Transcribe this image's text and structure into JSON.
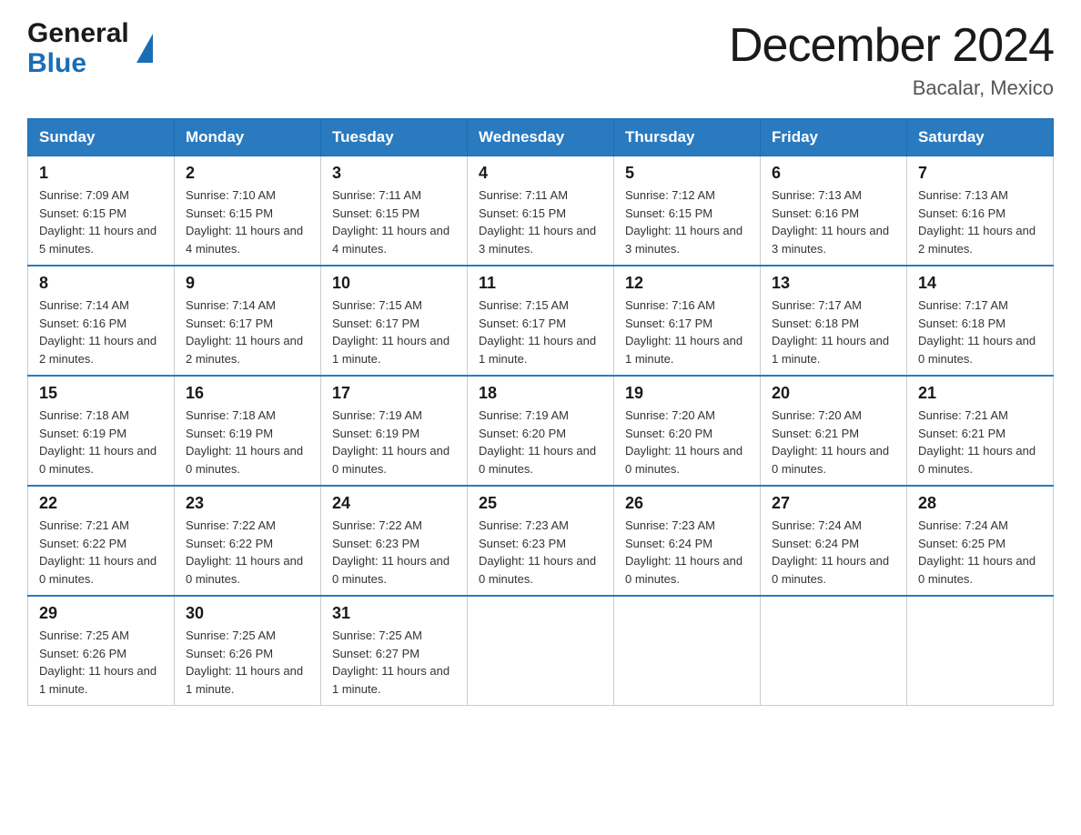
{
  "header": {
    "logo_general": "General",
    "logo_blue": "Blue",
    "month_title": "December 2024",
    "location": "Bacalar, Mexico"
  },
  "days_of_week": [
    "Sunday",
    "Monday",
    "Tuesday",
    "Wednesday",
    "Thursday",
    "Friday",
    "Saturday"
  ],
  "weeks": [
    [
      {
        "day": "1",
        "sunrise": "7:09 AM",
        "sunset": "6:15 PM",
        "daylight": "11 hours and 5 minutes."
      },
      {
        "day": "2",
        "sunrise": "7:10 AM",
        "sunset": "6:15 PM",
        "daylight": "11 hours and 4 minutes."
      },
      {
        "day": "3",
        "sunrise": "7:11 AM",
        "sunset": "6:15 PM",
        "daylight": "11 hours and 4 minutes."
      },
      {
        "day": "4",
        "sunrise": "7:11 AM",
        "sunset": "6:15 PM",
        "daylight": "11 hours and 3 minutes."
      },
      {
        "day": "5",
        "sunrise": "7:12 AM",
        "sunset": "6:15 PM",
        "daylight": "11 hours and 3 minutes."
      },
      {
        "day": "6",
        "sunrise": "7:13 AM",
        "sunset": "6:16 PM",
        "daylight": "11 hours and 3 minutes."
      },
      {
        "day": "7",
        "sunrise": "7:13 AM",
        "sunset": "6:16 PM",
        "daylight": "11 hours and 2 minutes."
      }
    ],
    [
      {
        "day": "8",
        "sunrise": "7:14 AM",
        "sunset": "6:16 PM",
        "daylight": "11 hours and 2 minutes."
      },
      {
        "day": "9",
        "sunrise": "7:14 AM",
        "sunset": "6:17 PM",
        "daylight": "11 hours and 2 minutes."
      },
      {
        "day": "10",
        "sunrise": "7:15 AM",
        "sunset": "6:17 PM",
        "daylight": "11 hours and 1 minute."
      },
      {
        "day": "11",
        "sunrise": "7:15 AM",
        "sunset": "6:17 PM",
        "daylight": "11 hours and 1 minute."
      },
      {
        "day": "12",
        "sunrise": "7:16 AM",
        "sunset": "6:17 PM",
        "daylight": "11 hours and 1 minute."
      },
      {
        "day": "13",
        "sunrise": "7:17 AM",
        "sunset": "6:18 PM",
        "daylight": "11 hours and 1 minute."
      },
      {
        "day": "14",
        "sunrise": "7:17 AM",
        "sunset": "6:18 PM",
        "daylight": "11 hours and 0 minutes."
      }
    ],
    [
      {
        "day": "15",
        "sunrise": "7:18 AM",
        "sunset": "6:19 PM",
        "daylight": "11 hours and 0 minutes."
      },
      {
        "day": "16",
        "sunrise": "7:18 AM",
        "sunset": "6:19 PM",
        "daylight": "11 hours and 0 minutes."
      },
      {
        "day": "17",
        "sunrise": "7:19 AM",
        "sunset": "6:19 PM",
        "daylight": "11 hours and 0 minutes."
      },
      {
        "day": "18",
        "sunrise": "7:19 AM",
        "sunset": "6:20 PM",
        "daylight": "11 hours and 0 minutes."
      },
      {
        "day": "19",
        "sunrise": "7:20 AM",
        "sunset": "6:20 PM",
        "daylight": "11 hours and 0 minutes."
      },
      {
        "day": "20",
        "sunrise": "7:20 AM",
        "sunset": "6:21 PM",
        "daylight": "11 hours and 0 minutes."
      },
      {
        "day": "21",
        "sunrise": "7:21 AM",
        "sunset": "6:21 PM",
        "daylight": "11 hours and 0 minutes."
      }
    ],
    [
      {
        "day": "22",
        "sunrise": "7:21 AM",
        "sunset": "6:22 PM",
        "daylight": "11 hours and 0 minutes."
      },
      {
        "day": "23",
        "sunrise": "7:22 AM",
        "sunset": "6:22 PM",
        "daylight": "11 hours and 0 minutes."
      },
      {
        "day": "24",
        "sunrise": "7:22 AM",
        "sunset": "6:23 PM",
        "daylight": "11 hours and 0 minutes."
      },
      {
        "day": "25",
        "sunrise": "7:23 AM",
        "sunset": "6:23 PM",
        "daylight": "11 hours and 0 minutes."
      },
      {
        "day": "26",
        "sunrise": "7:23 AM",
        "sunset": "6:24 PM",
        "daylight": "11 hours and 0 minutes."
      },
      {
        "day": "27",
        "sunrise": "7:24 AM",
        "sunset": "6:24 PM",
        "daylight": "11 hours and 0 minutes."
      },
      {
        "day": "28",
        "sunrise": "7:24 AM",
        "sunset": "6:25 PM",
        "daylight": "11 hours and 0 minutes."
      }
    ],
    [
      {
        "day": "29",
        "sunrise": "7:25 AM",
        "sunset": "6:26 PM",
        "daylight": "11 hours and 1 minute."
      },
      {
        "day": "30",
        "sunrise": "7:25 AM",
        "sunset": "6:26 PM",
        "daylight": "11 hours and 1 minute."
      },
      {
        "day": "31",
        "sunrise": "7:25 AM",
        "sunset": "6:27 PM",
        "daylight": "11 hours and 1 minute."
      },
      null,
      null,
      null,
      null
    ]
  ],
  "labels": {
    "sunrise": "Sunrise:",
    "sunset": "Sunset:",
    "daylight": "Daylight:"
  }
}
